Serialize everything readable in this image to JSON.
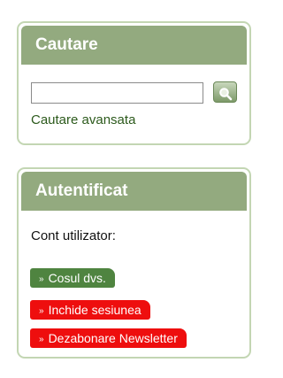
{
  "search_box": {
    "title": "Cautare",
    "input_value": "",
    "advanced_link": "Cautare avansata"
  },
  "auth_box": {
    "title": "Autentificat",
    "account_label": "Cont utilizator:",
    "actions": [
      {
        "label": "Cosul dvs.",
        "color": "#4f8440"
      },
      {
        "label": "Inchide sesiunea",
        "color": "#ee0e0e"
      },
      {
        "label": "Dezabonare Newsletter",
        "color": "#ee0e0e"
      }
    ]
  },
  "colors": {
    "header_bg": "#93aa7f",
    "border": "#c3d6b3",
    "link": "#2c5a1c"
  },
  "icons": {
    "search_button": "magnifier-icon",
    "action_bullet": "double-chevron-right-icon"
  }
}
